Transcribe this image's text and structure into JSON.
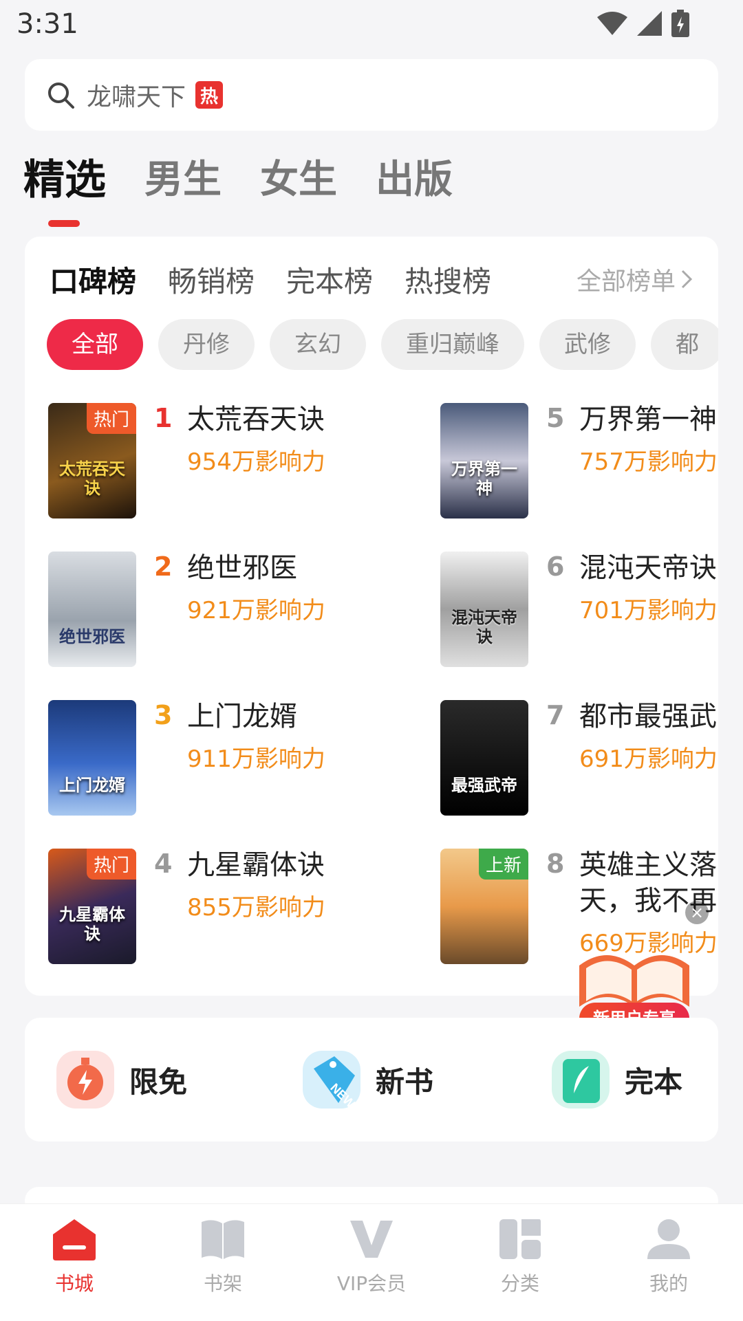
{
  "status": {
    "time": "3:31"
  },
  "search": {
    "query": "龙啸天下",
    "hot_label": "热"
  },
  "main_tabs": [
    "精选",
    "男生",
    "女生",
    "出版"
  ],
  "rank_tabs": [
    "口碑榜",
    "畅销榜",
    "完本榜",
    "热搜榜"
  ],
  "all_ranks_label": "全部榜单",
  "filters": [
    "全部",
    "丹修",
    "玄幻",
    "重归巅峰",
    "武修",
    "都"
  ],
  "books": [
    {
      "rank": "1",
      "title": "太荒吞天诀",
      "meta": "954万影响力",
      "tag": "热门",
      "cover_text": "太荒吞天诀"
    },
    {
      "rank": "2",
      "title": "绝世邪医",
      "meta": "921万影响力",
      "tag": "",
      "cover_text": "绝世邪医"
    },
    {
      "rank": "3",
      "title": "上门龙婿",
      "meta": "911万影响力",
      "tag": "",
      "cover_text": "上门龙婿"
    },
    {
      "rank": "4",
      "title": "九星霸体诀",
      "meta": "855万影响力",
      "tag": "热门",
      "cover_text": "九星霸体诀"
    },
    {
      "rank": "5",
      "title": "万界第一神",
      "meta": "757万影响力",
      "tag": "",
      "cover_text": "万界第一神"
    },
    {
      "rank": "6",
      "title": "混沌天帝诀",
      "meta": "701万影响力",
      "tag": "",
      "cover_text": "混沌天帝诀"
    },
    {
      "rank": "7",
      "title": "都市最强武",
      "meta": "691万影响力",
      "tag": "",
      "cover_text": "最强武帝"
    },
    {
      "rank": "8",
      "title": "英雄主义落天，我不再",
      "meta": "669万影响力",
      "tag": "上新",
      "cover_text": ""
    }
  ],
  "promo": {
    "label": "新用户专享"
  },
  "features": [
    {
      "label": "限免",
      "icon": "stopwatch-icon"
    },
    {
      "label": "新书",
      "icon": "new-tag-icon"
    },
    {
      "label": "完本",
      "icon": "feather-book-icon"
    }
  ],
  "tabbar": [
    {
      "label": "书城",
      "icon": "bookstore-icon"
    },
    {
      "label": "书架",
      "icon": "bookshelf-icon"
    },
    {
      "label": "VIP会员",
      "icon": "vip-icon"
    },
    {
      "label": "分类",
      "icon": "category-icon"
    },
    {
      "label": "我的",
      "icon": "profile-icon"
    }
  ],
  "colors": {
    "accent": "#e8322f",
    "chip_active": "#ee2a48",
    "meta": "#f28c1a",
    "rank_1": "#e8322f",
    "rank_2": "#f06a1a",
    "rank_3": "#f2a01a",
    "rank_other": "#999999"
  }
}
